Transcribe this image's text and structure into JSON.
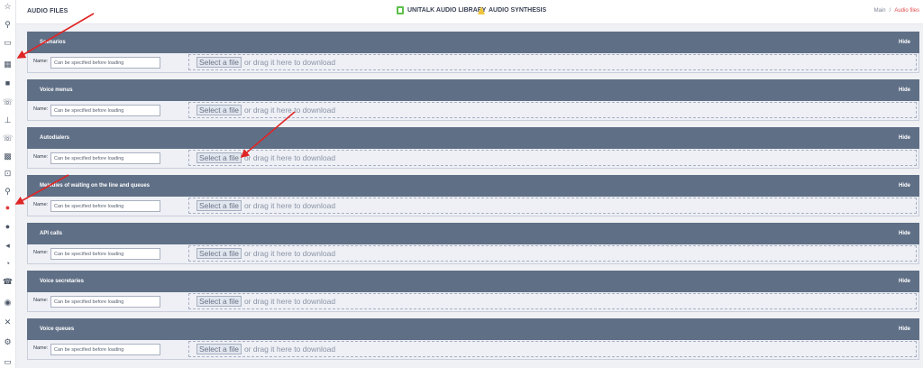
{
  "header": {
    "title": "AUDIO FILES",
    "links": [
      {
        "label": "UNITALK AUDIO LIBRARY",
        "icon": "book-icon",
        "color": "#5cc04a"
      },
      {
        "label": "AUDIO SYNTHESIS",
        "icon": "synthesis-icon",
        "color": "#f0c43a"
      }
    ],
    "breadcrumb": {
      "home": "Main",
      "separator": "/",
      "current": "Audio files"
    }
  },
  "sidebar": {
    "icons": [
      "star-icon",
      "magic-wand-icon",
      "chat-square-icon",
      "building-icon",
      "contact-book-icon",
      "phone-forward-icon",
      "org-chart-icon",
      "phone-callback-icon",
      "grid-icon",
      "clipboard-icon",
      "magic-wand-icon",
      "microphone-icon",
      "chat-bubble-icon",
      "megaphone-icon",
      "clock-icon",
      "telephone-icon",
      "chat-user-icon",
      "tools-icon",
      "gears-icon",
      "window-icon"
    ],
    "active_index": 11
  },
  "sections": [
    {
      "title": "Scenarios",
      "hide_label": "Hide",
      "name_label": "Name:",
      "name_placeholder": "Can be specified before loading",
      "select_label": "Select a file",
      "drop_text": "or drag it here to download"
    },
    {
      "title": "Voice menus",
      "hide_label": "Hide",
      "name_label": "Name:",
      "name_placeholder": "Can be specified before loading",
      "select_label": "Select a file",
      "drop_text": "or drag it here to download"
    },
    {
      "title": "Autodialers",
      "hide_label": "Hide",
      "name_label": "Name:",
      "name_placeholder": "Can be specified before loading",
      "select_label": "Select a file",
      "drop_text": "or drag it here to download"
    },
    {
      "title": "Melodies of waiting on the line and queues",
      "hide_label": "Hide",
      "name_label": "Name:",
      "name_placeholder": "Can be specified before loading",
      "select_label": "Select a file",
      "drop_text": "or drag it here to download"
    },
    {
      "title": "API calls",
      "hide_label": "Hide",
      "name_label": "Name:",
      "name_placeholder": "Can be specified before loading",
      "select_label": "Select a file",
      "drop_text": "or drag it here to download"
    },
    {
      "title": "Voice secretaries",
      "hide_label": "Hide",
      "name_label": "Name:",
      "name_placeholder": "Can be specified before loading",
      "select_label": "Select a file",
      "drop_text": "or drag it here to download"
    },
    {
      "title": "Voice queues",
      "hide_label": "Hide",
      "name_label": "Name:",
      "name_placeholder": "Can be specified before loading",
      "select_label": "Select a file",
      "drop_text": "or drag it here to download"
    }
  ],
  "colors": {
    "section_header": "#5f6f86",
    "arrow": "#e02525",
    "active_icon": "#e03b3b"
  }
}
